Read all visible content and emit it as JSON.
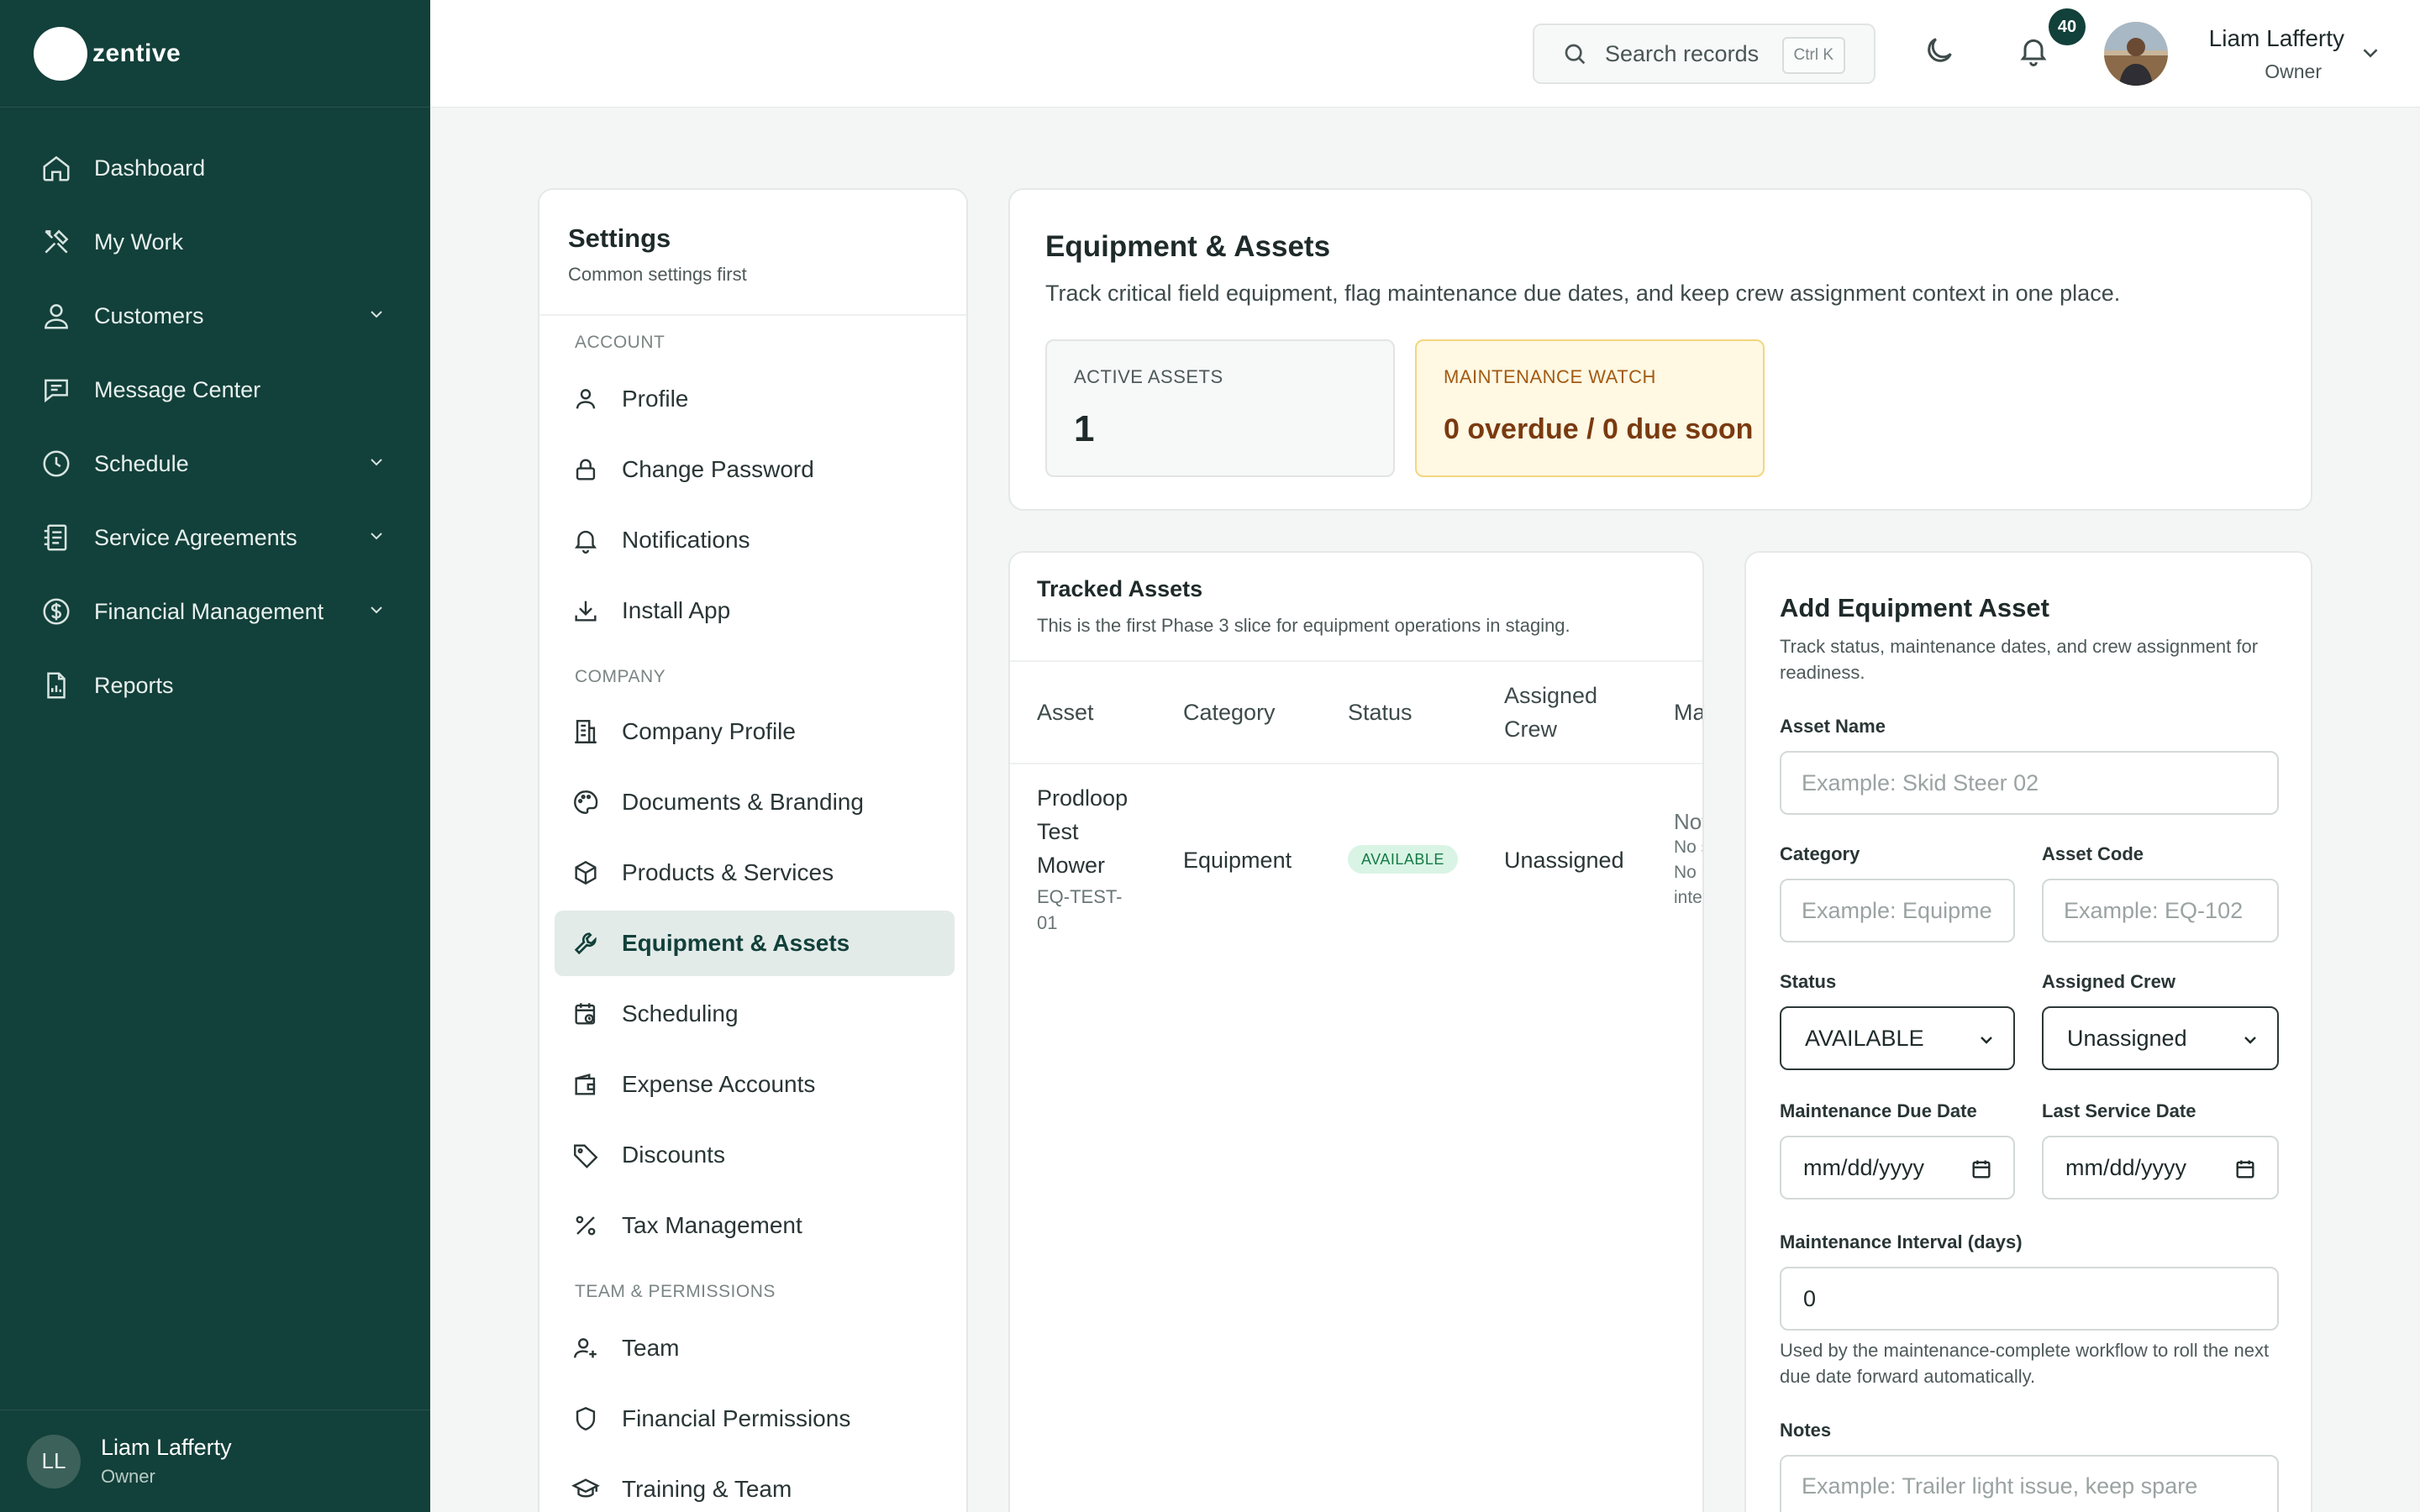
{
  "brand": {
    "name": "zentive"
  },
  "nav": {
    "items": [
      {
        "label": "Dashboard",
        "icon": "home-icon",
        "has_children": false
      },
      {
        "label": "My Work",
        "icon": "tools-icon",
        "has_children": false
      },
      {
        "label": "Customers",
        "icon": "users-icon",
        "has_children": true
      },
      {
        "label": "Message Center",
        "icon": "chat-icon",
        "has_children": false
      },
      {
        "label": "Schedule",
        "icon": "clock-icon",
        "has_children": true
      },
      {
        "label": "Service Agreements",
        "icon": "agreement-icon",
        "has_children": true
      },
      {
        "label": "Financial Management",
        "icon": "dollar-icon",
        "has_children": true
      },
      {
        "label": "Reports",
        "icon": "report-icon",
        "has_children": false
      }
    ]
  },
  "sidebar_user": {
    "initials": "LL",
    "name": "Liam Lafferty",
    "role": "Owner"
  },
  "topbar": {
    "search_placeholder": "Search records",
    "search_shortcut": "Ctrl K",
    "notification_count": "40",
    "user_name": "Liam Lafferty",
    "user_role": "Owner"
  },
  "settings": {
    "title": "Settings",
    "subtitle": "Common settings first",
    "sections": [
      {
        "heading": "ACCOUNT",
        "items": [
          "Profile",
          "Change Password",
          "Notifications",
          "Install App"
        ]
      },
      {
        "heading": "COMPANY",
        "items": [
          "Company Profile",
          "Documents & Branding",
          "Products & Services",
          "Equipment & Assets",
          "Scheduling",
          "Expense Accounts",
          "Discounts",
          "Tax Management"
        ]
      },
      {
        "heading": "TEAM & PERMISSIONS",
        "items": [
          "Team",
          "Financial Permissions",
          "Training & Team"
        ]
      }
    ],
    "active_item": "Equipment & Assets"
  },
  "header": {
    "title": "Equipment & Assets",
    "description": "Track critical field equipment, flag maintenance due dates, and keep crew assignment context in one place.",
    "stats": [
      {
        "label": "ACTIVE ASSETS",
        "value": "1"
      },
      {
        "label": "MAINTENANCE WATCH",
        "value": "0 overdue / 0 due soon"
      }
    ]
  },
  "tracked": {
    "title": "Tracked Assets",
    "subtitle": "This is the first Phase 3 slice for equipment operations in staging.",
    "columns": [
      "Asset",
      "Category",
      "Status",
      "Assigned Crew",
      "Ma"
    ],
    "rows": [
      {
        "asset_lines": [
          "Prodloop",
          "Test",
          "Mower"
        ],
        "code_lines": [
          "EQ-TEST-",
          "01"
        ],
        "category": "Equipment",
        "status": "AVAILABLE",
        "crew": "Unassigned",
        "maintenance_lines": [
          "Not",
          "No s",
          "No m",
          "inte"
        ]
      }
    ]
  },
  "form": {
    "title": "Add Equipment Asset",
    "subtitle": "Track status, maintenance dates, and crew assignment for readiness.",
    "asset_name_label": "Asset Name",
    "asset_name_placeholder": "Example: Skid Steer 02",
    "category_label": "Category",
    "category_placeholder": "Example: Equipment",
    "asset_code_label": "Asset Code",
    "asset_code_placeholder": "Example: EQ-102",
    "status_label": "Status",
    "status_value": "AVAILABLE",
    "crew_label": "Assigned Crew",
    "crew_value": "Unassigned",
    "due_date_label": "Maintenance Due Date",
    "due_date_value": "mm/dd/yyyy",
    "last_service_label": "Last Service Date",
    "last_service_value": "mm/dd/yyyy",
    "interval_label": "Maintenance Interval (days)",
    "interval_value": "0",
    "interval_help": "Used by the maintenance-complete workflow to roll the next due date forward automatically.",
    "notes_label": "Notes",
    "notes_placeholder": "Example: Trailer light issue, keep spare"
  },
  "colors": {
    "sidebar_bg": "#12403a",
    "active_item_bg": "#e3ebe9",
    "warning_bg": "#fff8e3",
    "warning_text": "#a35a12",
    "available_bg": "#d9f4e5",
    "available_text": "#157a45"
  }
}
